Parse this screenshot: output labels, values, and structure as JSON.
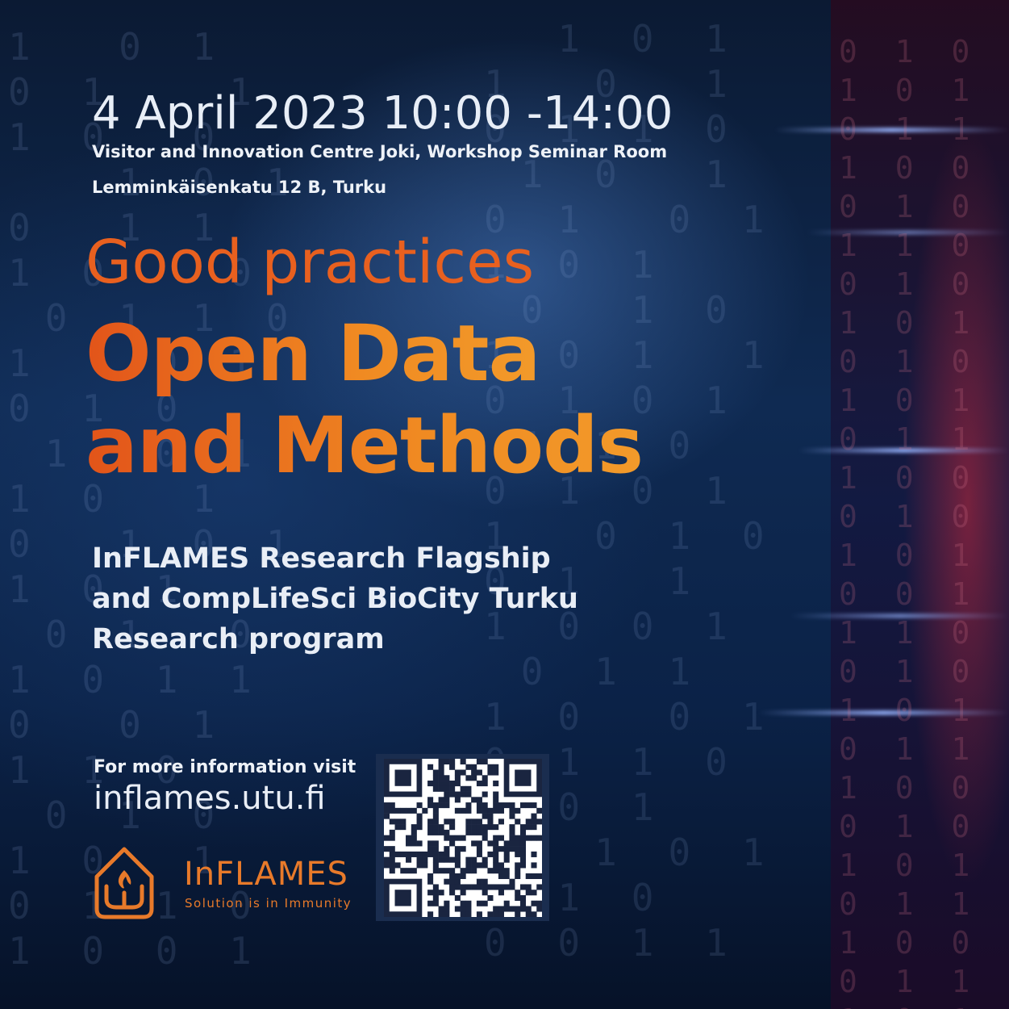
{
  "event": {
    "date_time": "4 April 2023  10:00 -14:00",
    "venue": "Visitor and Innovation Centre Joki, Workshop Seminar Room",
    "address": "Lemminkäisenkatu 12 B, Turku"
  },
  "title": {
    "kicker": "Good practices",
    "line1": "Open Data",
    "line2": "and Methods"
  },
  "organizers": {
    "line1": "InFLAMES Research Flagship",
    "line2": "and CompLifeSci BioCity Turku",
    "line3": "Research program"
  },
  "info": {
    "label": "For more information visit",
    "url": "inflames.utu.fi"
  },
  "logo": {
    "name": "InFLAMES",
    "tagline": "Solution is in Immunity",
    "icon": "flame-shield-icon"
  },
  "qr": {
    "icon": "qr-code-icon"
  },
  "colors": {
    "accent_orange": "#ee7a1e",
    "text_light": "#e9eef6",
    "background_navy": "#0f2a52"
  }
}
